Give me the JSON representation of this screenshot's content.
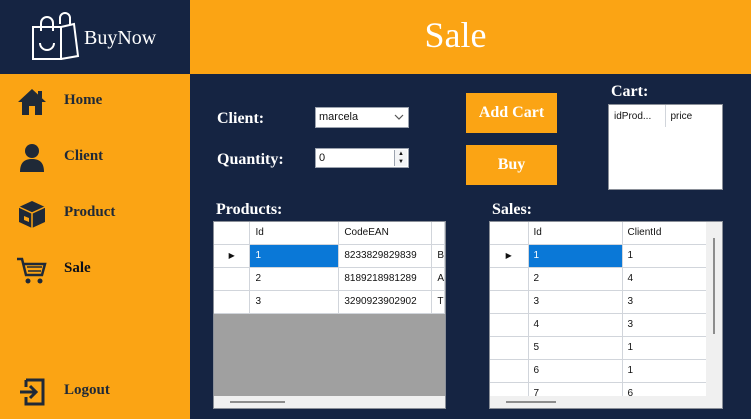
{
  "app": {
    "brand": "BuyNow"
  },
  "sidebar": {
    "items": [
      {
        "label": "Home",
        "icon": "home-icon"
      },
      {
        "label": "Client",
        "icon": "user-icon"
      },
      {
        "label": "Product",
        "icon": "box-icon"
      },
      {
        "label": "Sale",
        "icon": "cart-icon"
      }
    ],
    "logout": {
      "label": "Logout",
      "icon": "logout-icon"
    }
  },
  "header": {
    "title": "Sale"
  },
  "form": {
    "client_label": "Client:",
    "client_value": "marcela",
    "quantity_label": "Quantity:",
    "quantity_value": "0"
  },
  "buttons": {
    "add_cart": "Add Cart",
    "buy": "Buy"
  },
  "cart": {
    "label": "Cart:",
    "columns": [
      "idProd...",
      "price"
    ]
  },
  "products": {
    "label": "Products:",
    "columns": [
      "Id",
      "CodeEAN",
      ""
    ],
    "rows": [
      [
        "1",
        "8233829829839",
        "B"
      ],
      [
        "2",
        "8189218981289",
        "A"
      ],
      [
        "3",
        "3290923902902",
        "T"
      ]
    ]
  },
  "sales": {
    "label": "Sales:",
    "columns": [
      "Id",
      "ClientId"
    ],
    "rows": [
      [
        "1",
        "1"
      ],
      [
        "2",
        "4"
      ],
      [
        "3",
        "3"
      ],
      [
        "4",
        "3"
      ],
      [
        "5",
        "1"
      ],
      [
        "6",
        "1"
      ],
      [
        "7",
        "6"
      ]
    ]
  },
  "colors": {
    "navy": "#152442",
    "orange": "#fba414",
    "selection": "#0a78d7"
  }
}
